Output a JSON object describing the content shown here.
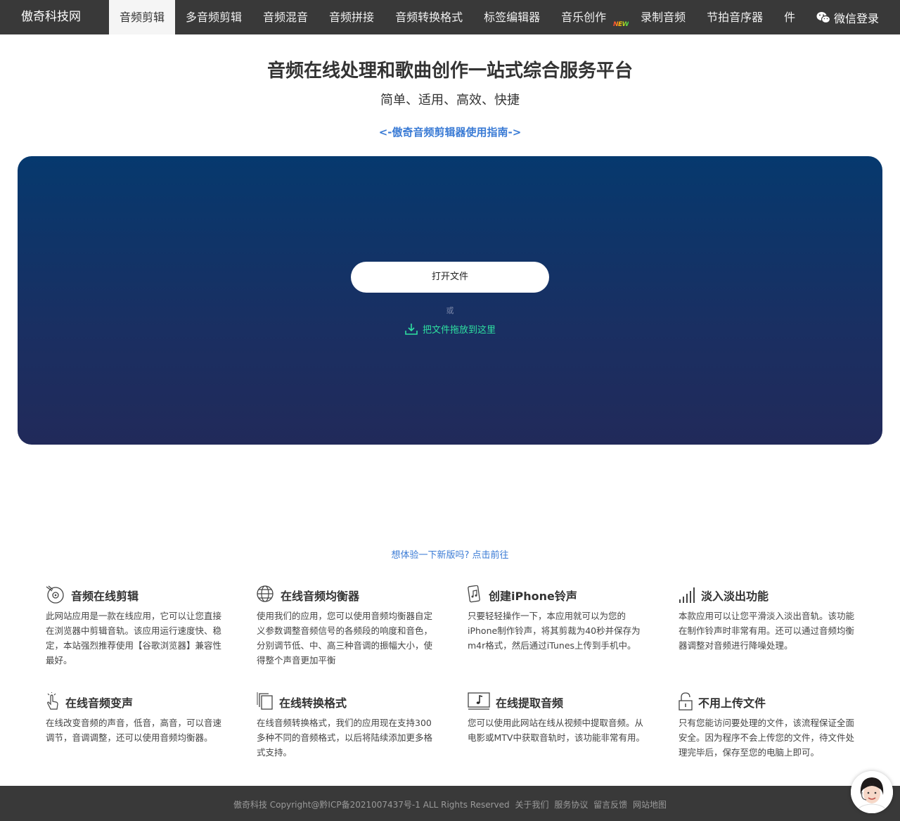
{
  "nav": {
    "brand": "傲奇科技网",
    "items": [
      {
        "label": "音频剪辑"
      },
      {
        "label": "多音频剪辑"
      },
      {
        "label": "音频混音"
      },
      {
        "label": "音频拼接"
      },
      {
        "label": "音频转换格式"
      },
      {
        "label": "标签编辑器"
      },
      {
        "label": "音乐创作",
        "badge": "NEW"
      },
      {
        "label": "录制音频"
      },
      {
        "label": "节拍音序器"
      },
      {
        "label": "件"
      }
    ],
    "login_label": "微信登录"
  },
  "hero": {
    "title": "音频在线处理和歌曲创作一站式综合服务平台",
    "subtitle": "简单、适用、高效、快捷",
    "guide_link": "<-傲奇音频剪辑器使用指南->"
  },
  "dropzone": {
    "open_button": "打开文件",
    "or_text": "或",
    "drag_text": "把文件拖放到这里"
  },
  "try_new": "想体验一下新版吗? 点击前往",
  "features": [
    {
      "icon": "cd-scissors-icon",
      "title": "音频在线剪辑",
      "desc": "此网站应用是一款在线应用，它可以让您直接在浏览器中剪辑音轨。该应用运行速度快、稳定，本站强烈推荐使用【谷歌浏览器】兼容性最好。"
    },
    {
      "icon": "globe-icon",
      "title": "在线音频均衡器",
      "desc": "使用我们的应用，您可以使用音频均衡器自定义参数调整音频信号的各频段的响度和音色，分别调节低、中、高三种音调的振幅大小，使得整个声音更加平衡"
    },
    {
      "icon": "phone-music-icon",
      "title": "创建iPhone铃声",
      "desc": "只要轻轻操作一下，本应用就可以为您的iPhone制作铃声，将其剪裁为40秒并保存为m4r格式，然后通过iTunes上传到手机中。"
    },
    {
      "icon": "signal-bars-icon",
      "title": "淡入淡出功能",
      "desc": "本款应用可以让您平滑淡入淡出音轨。该功能在制作铃声时非常有用。还可以通过音频均衡器调整对音频进行降噪处理。"
    },
    {
      "icon": "tap-hand-icon",
      "title": "在线音频变声",
      "desc": "在线改变音频的声音，低音，高音，可以音速调节，音调调整，还可以使用音频均衡器。"
    },
    {
      "icon": "files-icon",
      "title": "在线转换格式",
      "desc": "在线音频转换格式，我们的应用现在支持300多种不同的音频格式，以后将陆续添加更多格式支持。"
    },
    {
      "icon": "music-note-icon",
      "title": "在线提取音频",
      "desc": "您可以使用此网站在线从视频中提取音频。从电影或MTV中获取音轨时，该功能非常有用。"
    },
    {
      "icon": "lock-icon",
      "title": "不用上传文件",
      "desc": "只有您能访问要处理的文件，该流程保证全面安全。因为程序不会上传您的文件，待文件处理完毕后，保存至您的电脑上即可。"
    }
  ],
  "footer": {
    "copyright": "傲奇科技 Copyright@黔ICP备2021007437号-1 ALL Rights Reserved",
    "links": [
      "关于我们",
      "服务协议",
      "留言反馈",
      "网站地图"
    ]
  },
  "colors": {
    "nav_bg": "#393939",
    "accent_link": "#3a7bd5",
    "drag_text": "#2ee0a0",
    "dropzone_top": "#06396e",
    "dropzone_bottom": "#212a5a"
  }
}
